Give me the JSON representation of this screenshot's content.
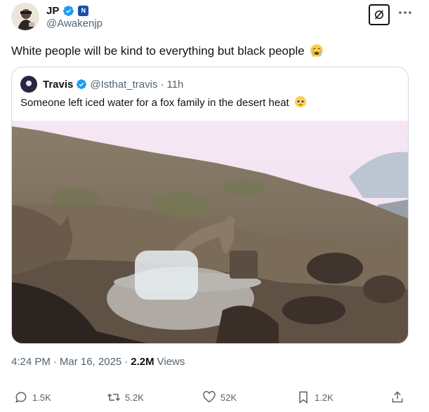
{
  "author": {
    "display_name": "JP",
    "handle": "@Awakenjp"
  },
  "tweet": {
    "text": "White people will be kind to everything but black people"
  },
  "quoted_tweet": {
    "display_name": "Travis",
    "handle": "@Isthat_travis",
    "separator": "·",
    "time": "11h",
    "text": "Someone left iced water for a fox family in the desert heat"
  },
  "meta": {
    "time": "4:24 PM",
    "sep1": "·",
    "date": "Mar 16, 2025",
    "sep2": "·",
    "views_count": "2.2M",
    "views_label": "Views"
  },
  "actions": {
    "replies": "1.5K",
    "reposts": "5.2K",
    "likes": "52K",
    "bookmarks": "1.2K"
  },
  "icons": {
    "verified": "verified-badge-icon",
    "affiliate": "affiliate-badge-icon",
    "grok": "grok-icon",
    "more": "more-icon",
    "reply": "reply-icon",
    "repost": "repost-icon",
    "like": "heart-icon",
    "bookmark": "bookmark-icon",
    "share": "share-icon"
  },
  "colors": {
    "verified_blue": "#1d9bf0",
    "secondary_text": "#536471",
    "border": "#cfd9de"
  }
}
